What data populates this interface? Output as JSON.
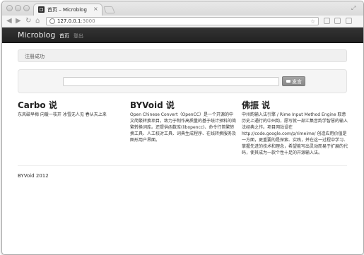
{
  "browser": {
    "tab_title": "首页 – Microblog",
    "tab_close": "×",
    "url_host": "127.0.0.1",
    "url_port": ":3000"
  },
  "navbar": {
    "brand": "Microblog",
    "links": [
      {
        "label": "首页",
        "active": true
      },
      {
        "label": "登出",
        "active": false
      }
    ]
  },
  "alert": {
    "text": "注册成功"
  },
  "post_form": {
    "input_value": "",
    "button_label": "发言"
  },
  "posts": [
    {
      "author": "Carbo 说",
      "body": "东风破早梅 向暖一枝开 冰雪无人见 春从天上来"
    },
    {
      "author": "BYVoid 说",
      "body": "Open Chinese Convert（OpenCC）是一个开源的中文简繁转换项目，致力于制作高质量的基于统计预料的简繁转换词库。还提供函数库(libopencc)、命令行简繁转换工具、人工校对工具、词典生成程序、在线转换服务及图形用户界面。"
    },
    {
      "author": "佛振 说",
      "body": "中州韵输入法引擎 / Rime Input Method Engine 取意历史上通行的中州韵，愿写就一部汇集音韵学智慧的输入法经典之作。项目网站设在 http://code.google.com/p/rimeime/ 创造应用价值是一方面，更重要的是探索、实践，并在这一过程中学习、掌握先进的技术和理念，希望能写出灵动而易于扩展的代码，使其成为一款个性十足的开源输入法。"
    }
  ],
  "footer": {
    "text": "BYVoid 2012"
  }
}
